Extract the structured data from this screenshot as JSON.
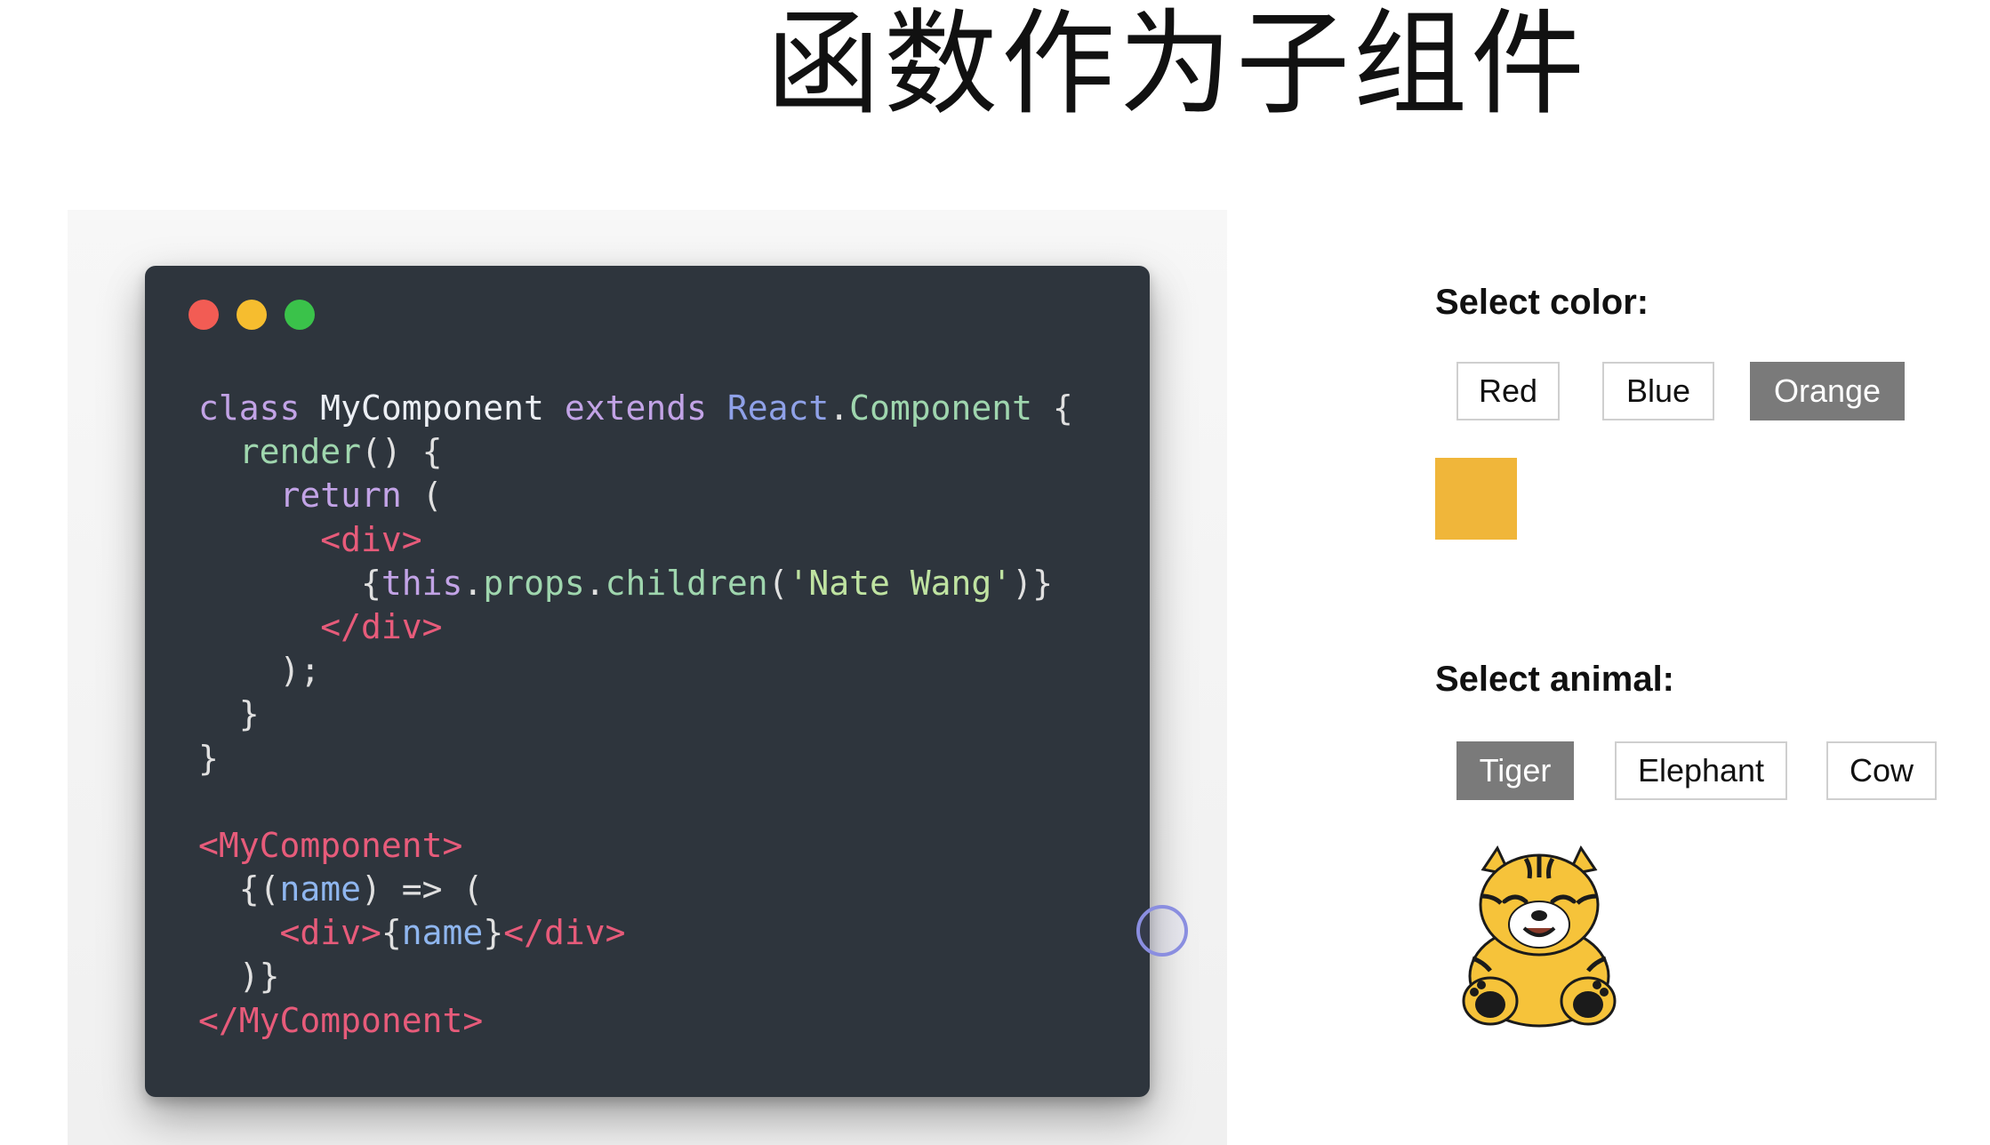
{
  "slide": {
    "title": "函数作为子组件"
  },
  "code_editor": {
    "lines": [
      [
        {
          "t": "class",
          "c": "kw"
        },
        {
          "t": " MyComponent ",
          "c": "cls"
        },
        {
          "t": "extends",
          "c": "kw"
        },
        {
          "t": " ",
          "c": "punc"
        },
        {
          "t": "React",
          "c": "ident"
        },
        {
          "t": ".",
          "c": "punc"
        },
        {
          "t": "Component",
          "c": "fn"
        },
        {
          "t": " {",
          "c": "punc"
        }
      ],
      [
        {
          "t": "  ",
          "c": "punc"
        },
        {
          "t": "render",
          "c": "fn"
        },
        {
          "t": "() {",
          "c": "punc"
        }
      ],
      [
        {
          "t": "    ",
          "c": "punc"
        },
        {
          "t": "return",
          "c": "kw"
        },
        {
          "t": " (",
          "c": "punc"
        }
      ],
      [
        {
          "t": "      ",
          "c": "punc"
        },
        {
          "t": "<div>",
          "c": "tag"
        }
      ],
      [
        {
          "t": "        {",
          "c": "punc"
        },
        {
          "t": "this",
          "c": "kw"
        },
        {
          "t": ".",
          "c": "punc"
        },
        {
          "t": "props",
          "c": "fn"
        },
        {
          "t": ".",
          "c": "punc"
        },
        {
          "t": "children",
          "c": "fn"
        },
        {
          "t": "(",
          "c": "punc"
        },
        {
          "t": "'Nate Wang'",
          "c": "str"
        },
        {
          "t": ")}",
          "c": "punc"
        }
      ],
      [
        {
          "t": "      ",
          "c": "punc"
        },
        {
          "t": "</div>",
          "c": "tag"
        }
      ],
      [
        {
          "t": "    );",
          "c": "punc"
        }
      ],
      [
        {
          "t": "  }",
          "c": "punc"
        }
      ],
      [
        {
          "t": "}",
          "c": "punc"
        }
      ],
      [
        {
          "t": "",
          "c": "punc"
        }
      ],
      [
        {
          "t": "<MyComponent>",
          "c": "tag"
        }
      ],
      [
        {
          "t": "  {(",
          "c": "punc"
        },
        {
          "t": "name",
          "c": "var"
        },
        {
          "t": ") => (",
          "c": "punc"
        }
      ],
      [
        {
          "t": "    ",
          "c": "punc"
        },
        {
          "t": "<div>",
          "c": "tag"
        },
        {
          "t": "{",
          "c": "punc"
        },
        {
          "t": "name",
          "c": "var"
        },
        {
          "t": "}",
          "c": "punc"
        },
        {
          "t": "</div>",
          "c": "tag"
        }
      ],
      [
        {
          "t": "  )}",
          "c": "punc"
        }
      ],
      [
        {
          "t": "</MyComponent>",
          "c": "tag"
        }
      ]
    ]
  },
  "color_picker": {
    "heading": "Select color:",
    "options": [
      "Red",
      "Blue",
      "Orange"
    ],
    "selected": "Orange",
    "swatch_color": "#f0b63a"
  },
  "animal_picker": {
    "heading": "Select animal:",
    "options": [
      "Tiger",
      "Elephant",
      "Cow"
    ],
    "selected": "Tiger",
    "image_icon": "tiger-icon"
  },
  "colors": {
    "selected_button_bg": "#7a7a7a",
    "code_background": "#2e353d"
  }
}
